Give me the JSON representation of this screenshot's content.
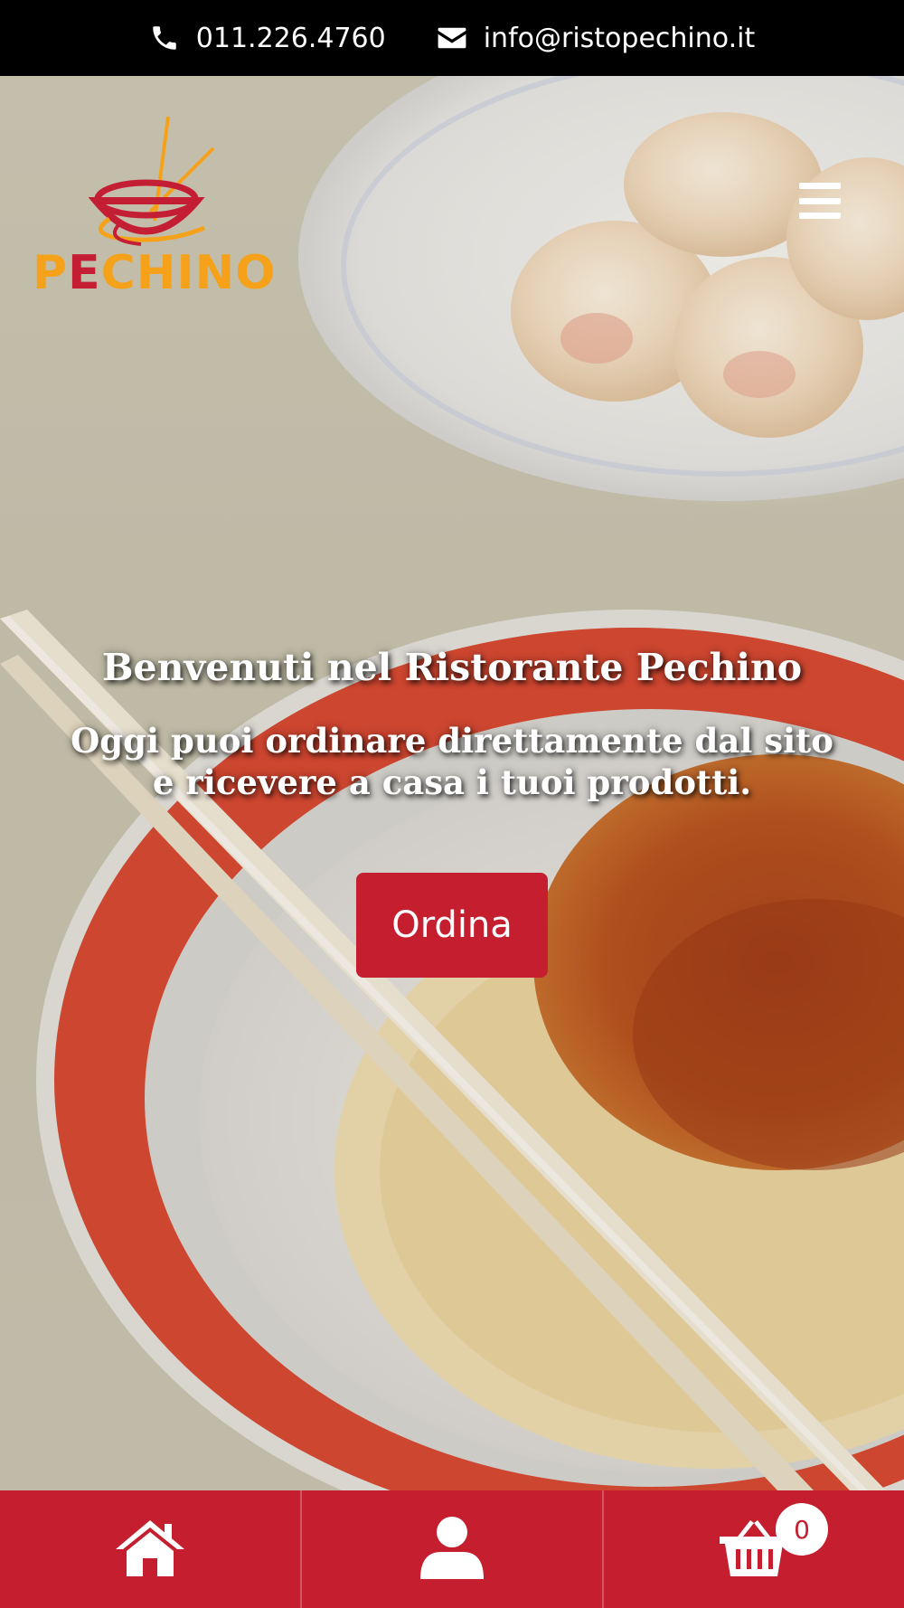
{
  "topbar": {
    "phone_icon": "phone-icon",
    "phone": "011.226.4760",
    "email_icon": "envelope-icon",
    "email": "info@ristopechino.it"
  },
  "logo": {
    "text_first": "P",
    "text_e": "E",
    "text_rest": "CHINO",
    "colors": {
      "orange": "#f5a21a",
      "red": "#c41e35"
    }
  },
  "header": {
    "menu_icon": "hamburger-menu-icon"
  },
  "hero": {
    "title": "Benvenuti nel Ristorante Pechino",
    "subtitle": "Oggi puoi ordinare direttamente dal sito e ricevere a casa i tuoi prodotti.",
    "order_button": "Ordina"
  },
  "bottom_nav": {
    "items": [
      {
        "icon": "home-icon"
      },
      {
        "icon": "user-icon"
      },
      {
        "icon": "cart-icon",
        "badge": "0"
      }
    ],
    "color": "#c41e2f"
  }
}
